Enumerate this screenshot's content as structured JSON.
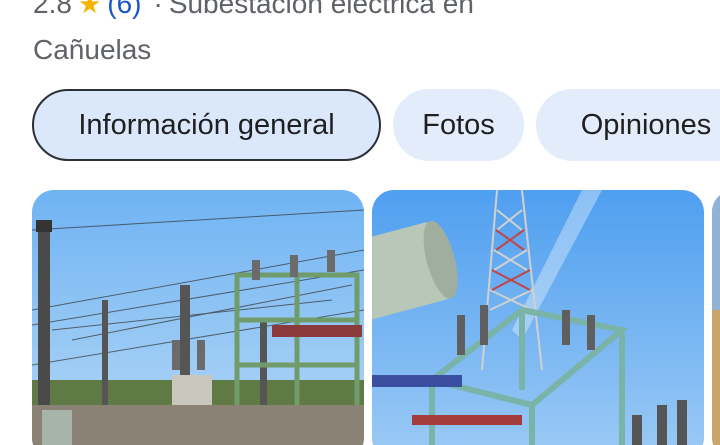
{
  "header": {
    "rating": "2.8",
    "star_icon": "star-icon",
    "review_count": "(6)",
    "separator": "·",
    "category": "Subestación eléctrica en",
    "location": "Cañuelas"
  },
  "tabs": [
    {
      "label": "Información general",
      "active": true
    },
    {
      "label": "Fotos",
      "active": false
    },
    {
      "label": "Opiniones",
      "active": false
    }
  ],
  "photos": [
    {
      "name": "substation-photo-1"
    },
    {
      "name": "substation-photo-2"
    },
    {
      "name": "substation-photo-3"
    }
  ],
  "colors": {
    "accent": "#1a56c8",
    "star": "#f4b400",
    "chip_bg": "#e3ecfb",
    "sky": "#5aa6f0"
  }
}
